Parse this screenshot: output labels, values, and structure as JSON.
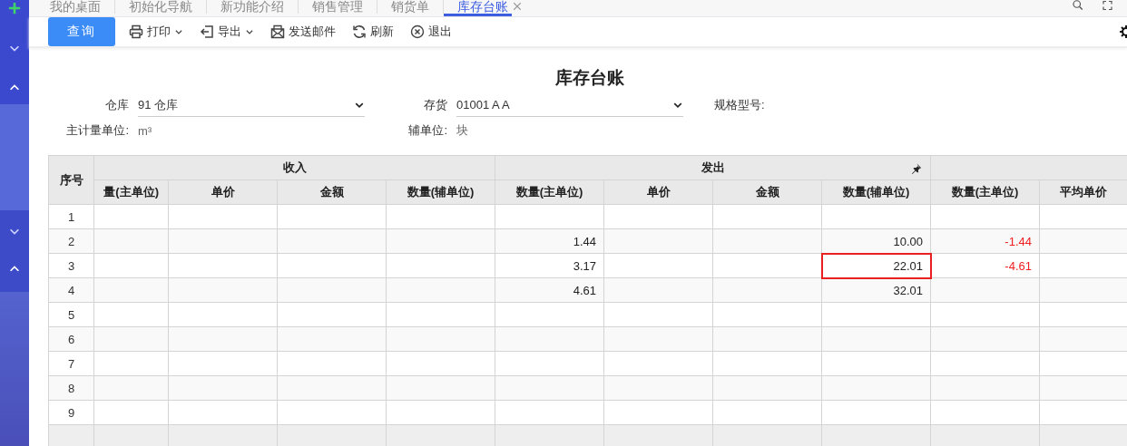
{
  "tabs": [
    {
      "label": "我的桌面",
      "selected": false
    },
    {
      "label": "初始化导航",
      "selected": false
    },
    {
      "label": "新功能介绍",
      "selected": false
    },
    {
      "label": "销售管理",
      "selected": false
    },
    {
      "label": "销货单",
      "selected": false
    },
    {
      "label": "库存台账",
      "selected": true
    }
  ],
  "toolbar": {
    "query_button": "查询",
    "actions": [
      {
        "label": "打印",
        "kind": "print",
        "menu": true
      },
      {
        "label": "导出",
        "kind": "export",
        "menu": true
      },
      {
        "label": "发送邮件",
        "kind": "mail",
        "menu": false
      },
      {
        "label": "刷新",
        "kind": "refresh",
        "menu": false
      },
      {
        "label": "退出",
        "kind": "exit",
        "menu": false
      }
    ]
  },
  "report": {
    "title": "库存台账",
    "fields": [
      [
        {
          "label": "仓库",
          "value": "91 仓库",
          "kind": "select"
        },
        {
          "label": "存货",
          "value": "01001 A A",
          "kind": "select"
        },
        {
          "label": "规格型号:",
          "kind": "text"
        }
      ],
      [
        {
          "label": "主计量单位:",
          "value": "m³",
          "kind": "text"
        },
        {
          "label": "辅单位:",
          "value": "块",
          "kind": "text"
        }
      ]
    ]
  },
  "table": {
    "number_header": "序号",
    "groups": [
      {
        "label": "收入",
        "pinned": false,
        "columns": [
          "量(主单位)",
          "单价",
          "金额",
          "数量(辅单位)"
        ]
      },
      {
        "label": "发出",
        "pinned": true,
        "columns": [
          "数量(主单位)",
          "单价",
          "金额",
          "数量(辅单位)"
        ]
      },
      {
        "pinned": false,
        "columns": [
          "数量(主单位)",
          "平均单价"
        ]
      }
    ],
    "rows": [
      {
        "number": "1",
        "cells": [
          null,
          null,
          null,
          null,
          null,
          null,
          null,
          null,
          null,
          null
        ]
      },
      {
        "number": "2",
        "cells": [
          null,
          null,
          null,
          null,
          {
            "text": "1.44",
            "negative": false,
            "highlighted": false
          },
          null,
          null,
          {
            "text": "10.00",
            "negative": false,
            "highlighted": false
          },
          {
            "text": "-1.44",
            "negative": true,
            "highlighted": false
          },
          null
        ]
      },
      {
        "number": "3",
        "cells": [
          null,
          null,
          null,
          null,
          {
            "text": "3.17",
            "negative": false,
            "highlighted": false
          },
          null,
          null,
          {
            "text": "22.01",
            "negative": false,
            "highlighted": true
          },
          {
            "text": "-4.61",
            "negative": true,
            "highlighted": false
          },
          null
        ]
      },
      {
        "number": "4",
        "cells": [
          null,
          null,
          null,
          null,
          {
            "text": "4.61",
            "negative": false,
            "highlighted": false
          },
          null,
          null,
          {
            "text": "32.01",
            "negative": false,
            "highlighted": false
          },
          null,
          null
        ]
      },
      {
        "number": "5",
        "cells": [
          null,
          null,
          null,
          null,
          null,
          null,
          null,
          null,
          null,
          null
        ]
      },
      {
        "number": "6",
        "cells": [
          null,
          null,
          null,
          null,
          null,
          null,
          null,
          null,
          null,
          null
        ]
      },
      {
        "number": "7",
        "cells": [
          null,
          null,
          null,
          null,
          null,
          null,
          null,
          null,
          null,
          null
        ]
      },
      {
        "number": "8",
        "cells": [
          null,
          null,
          null,
          null,
          null,
          null,
          null,
          null,
          null,
          null
        ]
      },
      {
        "number": "9",
        "cells": [
          null,
          null,
          null,
          null,
          null,
          null,
          null,
          null,
          null,
          null
        ]
      }
    ]
  }
}
